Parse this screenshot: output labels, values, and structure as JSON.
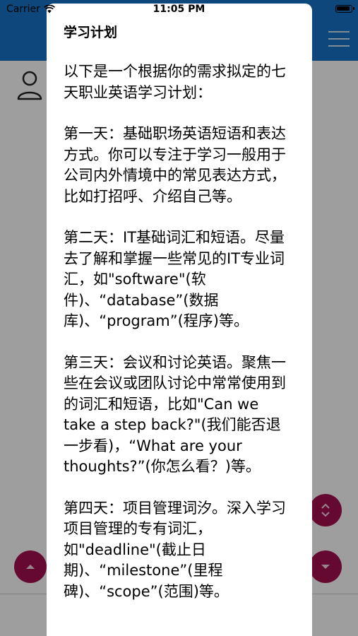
{
  "status_bar": {
    "carrier": "Carrier",
    "time": "11:05 PM"
  },
  "modal": {
    "title": "学习计划",
    "paragraphs": [
      "以下是一个根据你的需求拟定的七天职业英语学习计划：",
      "第一天：基础职场英语短语和表达方式。你可以专注于学习一般用于公司内外情境中的常见表达方式，比如打招呼、介绍自己等。",
      "第二天：IT基础词汇和短语。尽量去了解和掌握一些常见的IT专业词汇，如\"software\"(软件)、“database”(数据库)、“program”(程序)等。",
      "第三天：会议和讨论英语。聚焦一些在会议或团队讨论中常常使用到的词汇和短语，比如\"Can we take a step back?\"(我们能否退一步看)，“What are your thoughts?”(你怎么看？)等。",
      "第四天：项目管理词汐。深入学习项目管理的专有词汇，如\"deadline\"(截止日期)、“milestone”(里程碑)、“scope”(范围)等。"
    ]
  },
  "icons": {
    "wifi": "wifi-icon",
    "battery": "battery-icon",
    "menu": "hamburger-menu-icon",
    "avatar": "user-icon",
    "scroll_up": "chevron-up-icon",
    "expand": "expand-icon",
    "scroll_down": "chevron-down-icon"
  },
  "colors": {
    "header_blue": "#1673c7",
    "fab_magenta": "#a3104f",
    "overlay": "rgba(0,0,0,0.38)"
  }
}
